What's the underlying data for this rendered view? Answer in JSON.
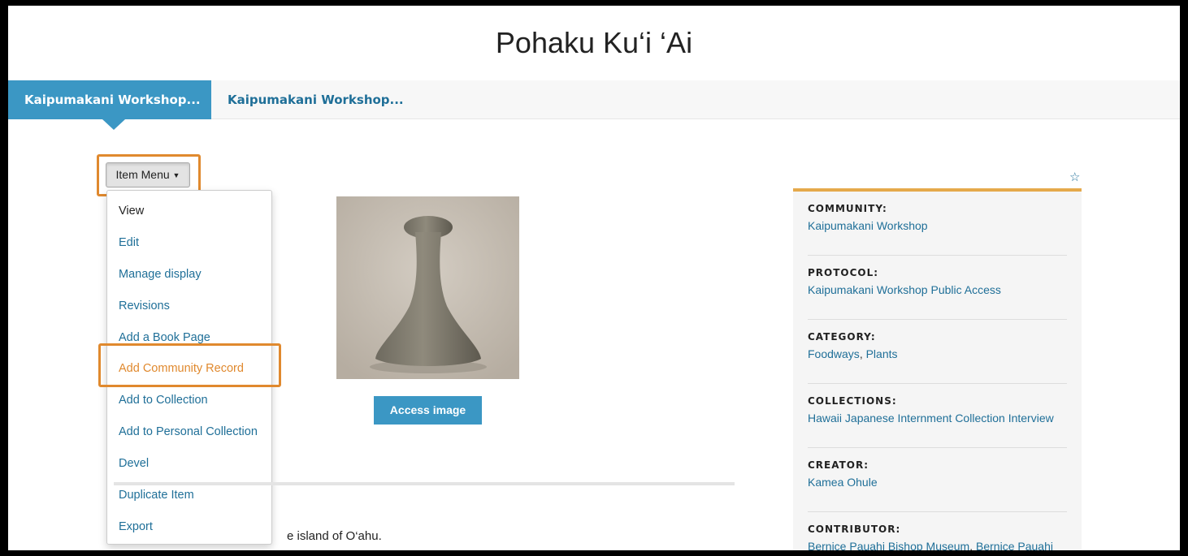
{
  "page": {
    "title": "Pohaku Ku‘i ‘Ai"
  },
  "tabs": [
    {
      "label": "Kaipumakani Workshop..."
    },
    {
      "label": "Kaipumakani Workshop..."
    }
  ],
  "item_menu": {
    "button_label": "Item Menu",
    "items": [
      {
        "label": "View"
      },
      {
        "label": "Edit"
      },
      {
        "label": "Manage display"
      },
      {
        "label": "Revisions"
      },
      {
        "label": "Add a Book Page"
      },
      {
        "label": "Add Community Record"
      },
      {
        "label": "Add to Collection"
      },
      {
        "label": "Add to Personal Collection"
      },
      {
        "label": "Devel"
      },
      {
        "label": "Duplicate Item"
      },
      {
        "label": "Export"
      }
    ]
  },
  "main": {
    "access_image_label": "Access image",
    "body_text": "e island of O‘ahu."
  },
  "sidebar": {
    "star_icon": "star-outline-icon",
    "community": {
      "label": "COMMUNITY:",
      "value": "Kaipumakani Workshop"
    },
    "protocol": {
      "label": "PROTOCOL:",
      "value": "Kaipumakani Workshop Public Access"
    },
    "category": {
      "label": "CATEGORY:",
      "values": [
        "Foodways",
        "Plants"
      ],
      "separator": ", "
    },
    "collections": {
      "label": "COLLECTIONS:",
      "value": "Hawaii Japanese Internment Collection Interview"
    },
    "creator": {
      "label": "CREATOR:",
      "value": "Kamea Ohule"
    },
    "contributor": {
      "label": "CONTRIBUTOR:",
      "values": [
        "Bernice Pauahi Bishop Museum",
        "Bernice Pauahi"
      ],
      "separator": ", "
    }
  },
  "colors": {
    "accent_blue": "#3b97c4",
    "link_blue": "#1f6f98",
    "highlight_orange": "#e0892e",
    "sidebar_top_border": "#e5a94b"
  }
}
